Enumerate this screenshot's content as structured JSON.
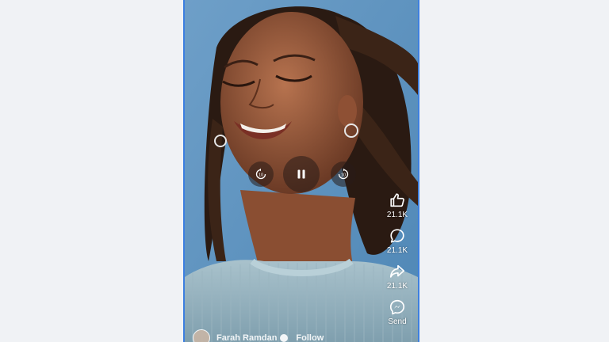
{
  "video": {
    "description": "Portrait of a smiling woman with eyes closed, locs blowing in the wind, blue sky background, light blue knit sweater"
  },
  "controls": {
    "skip_back_seconds": "10",
    "skip_forward_seconds": "10",
    "state": "playing"
  },
  "actions": [
    {
      "icon": "like-icon",
      "count": "21.1K"
    },
    {
      "icon": "comment-icon",
      "count": "21.1K"
    },
    {
      "icon": "share-icon",
      "count": "21.1K"
    },
    {
      "icon": "messenger-icon",
      "count": "Send"
    }
  ],
  "author": {
    "name": "Farah Ramdan",
    "follow_label": "Follow"
  },
  "colors": {
    "frame_border": "#3d7fe0",
    "page_background": "#f0f2f5"
  }
}
